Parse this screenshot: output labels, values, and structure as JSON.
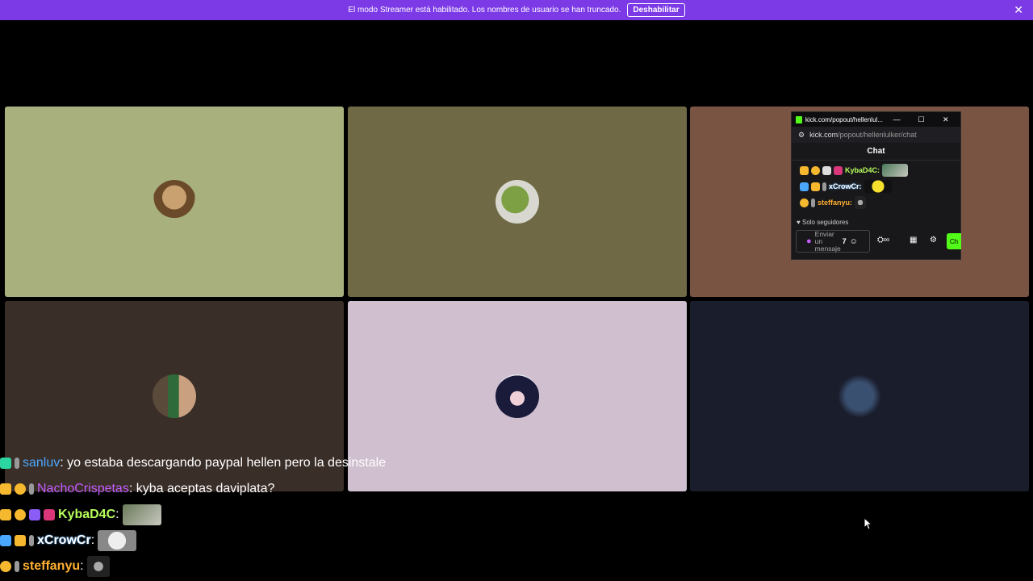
{
  "banner": {
    "message": "El modo Streamer está habilitado. Los nombres de usuario se han truncado.",
    "button_label": "Deshabilitar",
    "close": "✕"
  },
  "tiles": [
    {
      "color": "#a8b07e"
    },
    {
      "color": "#6f6a45"
    },
    {
      "color": "#7a5442"
    },
    {
      "color": "#3a2e28"
    },
    {
      "color": "#cfbfcf"
    },
    {
      "color": "#1a1d2c"
    }
  ],
  "overlay_chat": [
    {
      "user": "sanluv",
      "user_color": "#4aa8ff",
      "text": ": yo estaba descargando paypal hellen pero la desinstale"
    },
    {
      "user": "NachoCrispetas",
      "user_color": "#c45cff",
      "text": ": kyba aceptas daviplata?"
    },
    {
      "user": "KybaD4C",
      "user_color": "#b8ff5c",
      "text": ":"
    },
    {
      "user": "xCrowCr",
      "user_color": "#4aa8ff",
      "text": ":"
    },
    {
      "user": "steffanyu",
      "user_color": "#ffb030",
      "text": ":"
    }
  ],
  "popout": {
    "window_title": "kick.com/popout/hellenlul...",
    "url_domain": "kick.com",
    "url_path": "/popout/hellenlulker/chat",
    "header": "Chat",
    "messages": [
      {
        "user": "KybaD4C:",
        "user_color": "#b8ff5c"
      },
      {
        "user": "xCrowCr:",
        "user_color": "#4aa8ff"
      },
      {
        "user": "steffanyu:",
        "user_color": "#ffb030"
      }
    ],
    "followers_only": "Solo seguidores",
    "input_placeholder_1": "Enviar",
    "input_placeholder_2": "un",
    "input_placeholder_3": "mensaje",
    "send_label": "Ch",
    "min": "—",
    "max": "☐",
    "close": "✕"
  }
}
